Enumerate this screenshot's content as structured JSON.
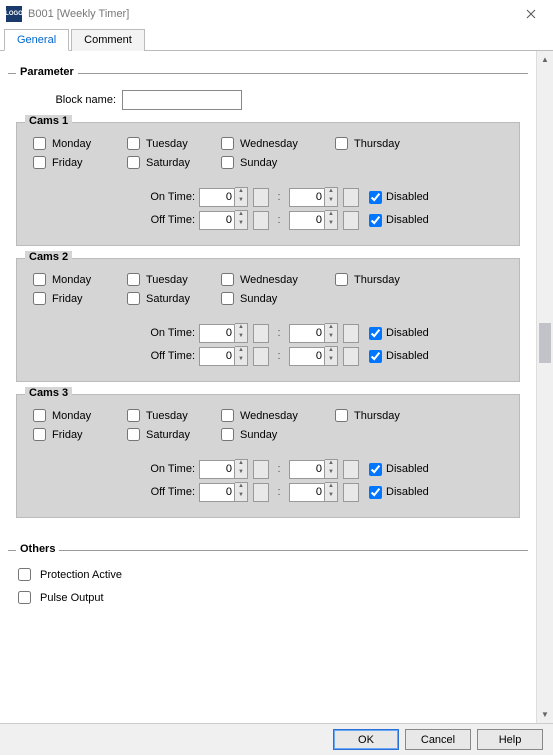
{
  "window": {
    "title": "B001 [Weekly Timer]",
    "icon_text": "LOGO"
  },
  "tabs": {
    "general": "General",
    "comment": "Comment"
  },
  "param_section": {
    "legend": "Parameter",
    "block_name_label": "Block name:",
    "block_name_value": ""
  },
  "days": {
    "mon": "Monday",
    "tue": "Tuesday",
    "wed": "Wednesday",
    "thu": "Thursday",
    "fri": "Friday",
    "sat": "Saturday",
    "sun": "Sunday"
  },
  "time_labels": {
    "on": "On Time:",
    "off": "Off Time:",
    "disabled": "Disabled",
    "colon": ":"
  },
  "cams": [
    {
      "legend": "Cams 1",
      "days": {
        "mon": false,
        "tue": false,
        "wed": false,
        "thu": false,
        "fri": false,
        "sat": false,
        "sun": false
      },
      "on": {
        "h": "0",
        "m": "0",
        "disabled": true
      },
      "off": {
        "h": "0",
        "m": "0",
        "disabled": true
      }
    },
    {
      "legend": "Cams 2",
      "days": {
        "mon": false,
        "tue": false,
        "wed": false,
        "thu": false,
        "fri": false,
        "sat": false,
        "sun": false
      },
      "on": {
        "h": "0",
        "m": "0",
        "disabled": true
      },
      "off": {
        "h": "0",
        "m": "0",
        "disabled": true
      }
    },
    {
      "legend": "Cams 3",
      "days": {
        "mon": false,
        "tue": false,
        "wed": false,
        "thu": false,
        "fri": false,
        "sat": false,
        "sun": false
      },
      "on": {
        "h": "0",
        "m": "0",
        "disabled": true
      },
      "off": {
        "h": "0",
        "m": "0",
        "disabled": true
      }
    }
  ],
  "others": {
    "legend": "Others",
    "protection": "Protection Active",
    "protection_checked": false,
    "pulse": "Pulse Output",
    "pulse_checked": false
  },
  "buttons": {
    "ok": "OK",
    "cancel": "Cancel",
    "help": "Help"
  }
}
